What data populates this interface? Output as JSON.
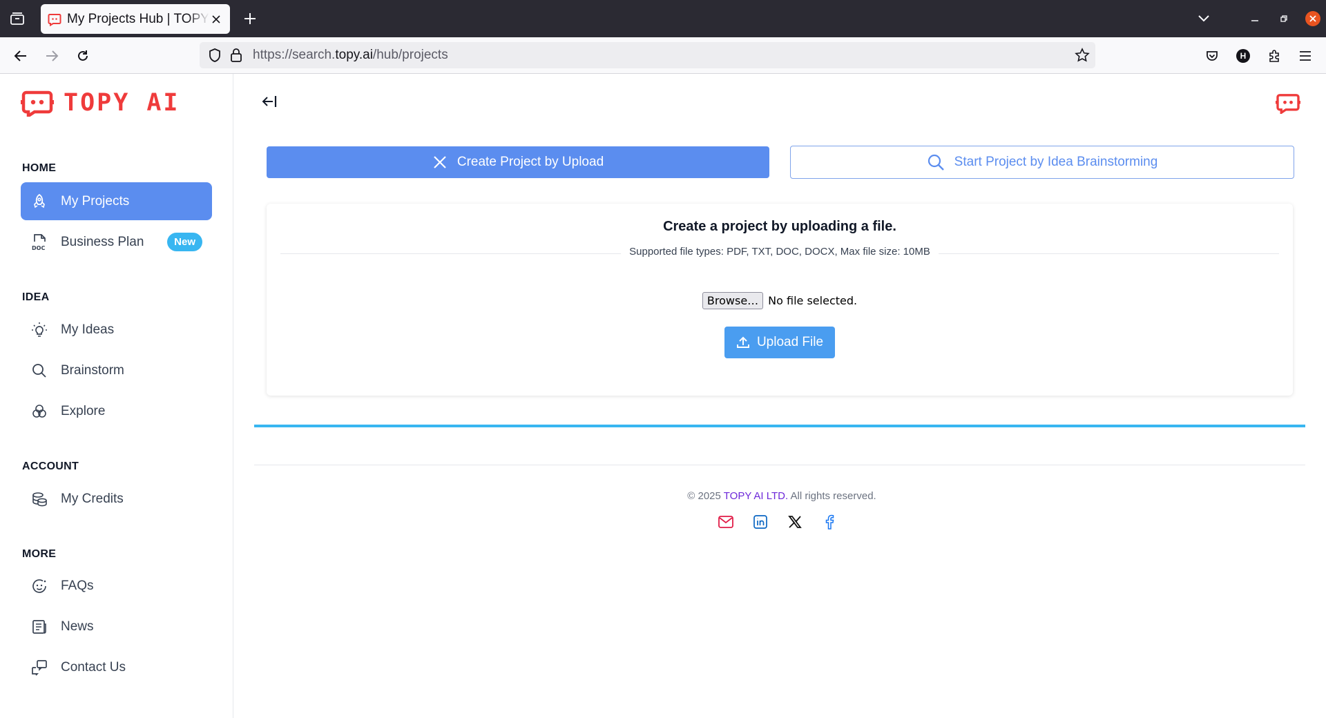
{
  "browser": {
    "tab_title": "My Projects Hub | TOPY AI",
    "url_prefix": "https://search.",
    "url_domain": "topy.ai",
    "url_path": "/hub/projects",
    "profile_initial": "H"
  },
  "brand": {
    "name": "TOPY AI",
    "color": "#ef3b3b"
  },
  "sidebar": {
    "sections": [
      {
        "title": "HOME",
        "items": [
          {
            "label": "My Projects",
            "icon": "rocket-icon",
            "active": true
          },
          {
            "label": "Business Plan",
            "icon": "doc-file-icon",
            "badge": "New"
          }
        ]
      },
      {
        "title": "IDEA",
        "items": [
          {
            "label": "My Ideas",
            "icon": "lightbulb-icon"
          },
          {
            "label": "Brainstorm",
            "icon": "search-icon"
          },
          {
            "label": "Explore",
            "icon": "network-icon"
          }
        ]
      },
      {
        "title": "ACCOUNT",
        "items": [
          {
            "label": "My Credits",
            "icon": "coins-icon"
          }
        ]
      },
      {
        "title": "MORE",
        "items": [
          {
            "label": "FAQs",
            "icon": "faq-icon"
          },
          {
            "label": "News",
            "icon": "news-icon"
          },
          {
            "label": "Contact Us",
            "icon": "contact-icon"
          }
        ]
      }
    ]
  },
  "main": {
    "mode_buttons": {
      "upload": "Create Project by Upload",
      "brainstorm": "Start Project by Idea Brainstorming"
    },
    "card": {
      "title": "Create a project by uploading a file.",
      "file_types": "Supported file types: PDF, TXT, DOC, DOCX, Max file size: 10MB",
      "browse_label": "Browse…",
      "file_status": "No file selected.",
      "upload_label": "Upload File"
    },
    "footer": {
      "copyright_prefix": "© 2025 ",
      "company": "TOPY AI LTD.",
      "copyright_suffix": " All rights reserved.",
      "socials": [
        "mail-icon",
        "linkedin-icon",
        "x-icon",
        "facebook-icon"
      ]
    }
  },
  "colors": {
    "accent": "#5b8def",
    "progress": "#38b6f1",
    "badge": "#38b6f1"
  }
}
